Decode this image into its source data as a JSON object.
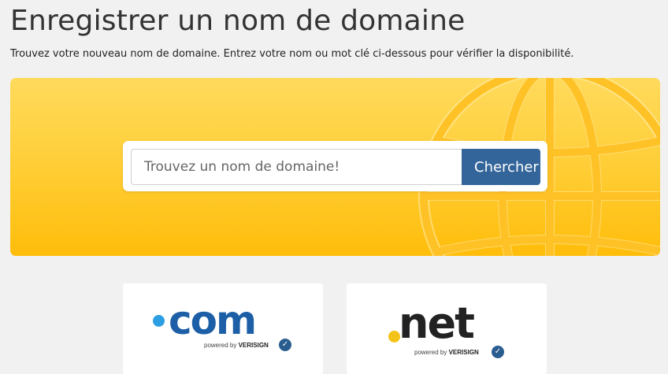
{
  "page": {
    "title": "Enregistrer un nom de domaine",
    "subtitle": "Trouvez votre nouveau nom de domaine. Entrez votre nom ou mot clé ci-dessous pour vérifier la disponibilité."
  },
  "search": {
    "placeholder": "Trouvez un nom de domaine!",
    "value": "",
    "button_label": "Chercher"
  },
  "tlds": [
    {
      "name": ".com",
      "text": "com",
      "powered_by": "powered by",
      "brand": "VERISIGN",
      "dot_color": "#2c9fe3",
      "text_color": "#1d5fa6"
    },
    {
      "name": ".net",
      "text": "net",
      "powered_by": "powered by",
      "brand": "VERISIGN",
      "dot_color": "#f4c31a",
      "text_color": "#222222"
    }
  ],
  "colors": {
    "hero_top": "#ffda5c",
    "hero_bottom": "#ffbd0a",
    "button": "#33659a",
    "background": "#f1f1f1"
  },
  "icons": {
    "hero_decoration": "globe-icon",
    "brand": "verisign-check-icon"
  }
}
